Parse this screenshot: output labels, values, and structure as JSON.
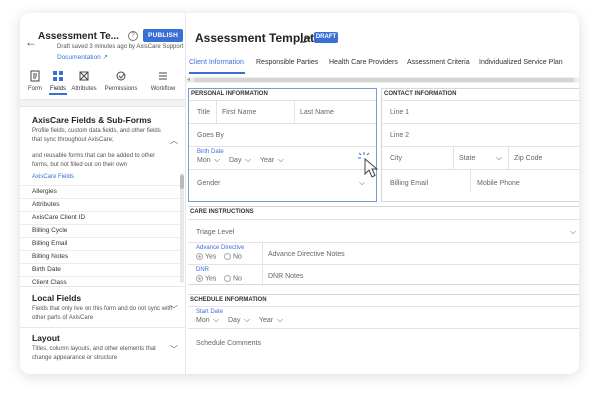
{
  "sidebar": {
    "title": "Assessment Te...",
    "publish_label": "PUBLISH",
    "saved_text": "Draft saved 3 minutes ago by AxisCare Support",
    "documentation_label": "Documentation ↗",
    "tabs": [
      {
        "label": "Form",
        "icon": "form-icon"
      },
      {
        "label": "Fields",
        "icon": "fields-icon"
      },
      {
        "label": "Attributes",
        "icon": "attributes-icon"
      },
      {
        "label": "Permissions",
        "icon": "permissions-icon"
      },
      {
        "label": "Workflow",
        "icon": "workflow-icon"
      }
    ],
    "active_tab": "Fields",
    "axiscare_section": {
      "title": "AxisCare Fields & Sub-Forms",
      "desc_1": "Profile fields, custom data fields, and other fields that sync throughout AxisCare;",
      "desc_2": "and reusable forms that can be added to other forms, but not filled out on their own",
      "fields_label": "AxisCare Fields",
      "items": [
        "Allergies",
        "Attributes",
        "AxisCare Client ID",
        "Billing Cycle",
        "Billing Email",
        "Billing Notes",
        "Birth Date",
        "Client Class"
      ]
    },
    "local_section": {
      "title": "Local Fields",
      "desc": "Fields that only live on this form and do not sync with other parts of AxisCare"
    },
    "layout_section": {
      "title": "Layout",
      "desc": "Titles, column layouts, and other elements that change appearance or structure"
    }
  },
  "main": {
    "title": "Assessment Template",
    "draft_badge": "DRAFT",
    "tabs": [
      "Client Information",
      "Responsible Parties",
      "Health Care Providers",
      "Assessment Criteria",
      "Individualized Service Plan"
    ],
    "active_tab": "Client Information",
    "personal": {
      "title": "PERSONAL INFORMATION",
      "title_field": "Title",
      "first_name": "First Name",
      "last_name": "Last Name",
      "goes_by": "Goes By",
      "birth_date_label": "Birth Date",
      "mon": "Mon",
      "day": "Day",
      "year": "Year",
      "gender": "Gender"
    },
    "contact": {
      "title": "CONTACT INFORMATION",
      "line1": "Line 1",
      "line2": "Line 2",
      "city": "City",
      "state": "State",
      "zip": "Zip Code",
      "billing_email": "Billing Email",
      "mobile_phone": "Mobile Phone"
    },
    "care": {
      "title": "CARE INSTRUCTIONS",
      "triage": "Triage Level",
      "adv_label": "Advance Directive",
      "yes": "Yes",
      "no": "No",
      "adv_notes": "Advance Directive Notes",
      "dnr_label": "DNR",
      "dnr_notes": "DNR Notes"
    },
    "schedule": {
      "title": "SCHEDULE INFORMATION",
      "start_date": "Start Date",
      "mon": "Mon",
      "day": "Day",
      "year": "Year",
      "comments": "Schedule Comments"
    }
  },
  "colors": {
    "accent": "#3a6fd8",
    "highlight_border": "#7c9bd6"
  }
}
